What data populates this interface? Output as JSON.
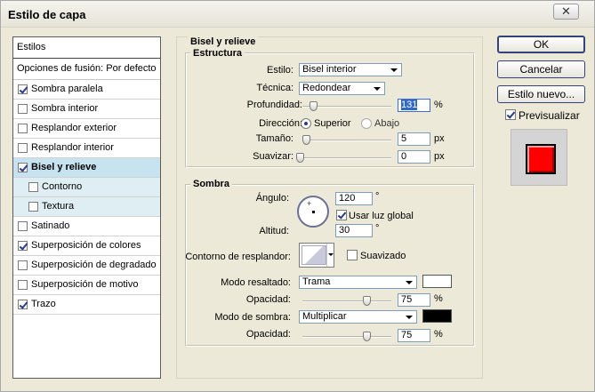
{
  "window": {
    "title": "Estilo de capa",
    "close_label": "✕"
  },
  "styles": {
    "header": "Estilos",
    "blend_options": "Opciones de fusión: Por defecto",
    "items": [
      {
        "label": "Sombra paralela",
        "checked": true
      },
      {
        "label": "Sombra interior",
        "checked": false
      },
      {
        "label": "Resplandor exterior",
        "checked": false
      },
      {
        "label": "Resplandor interior",
        "checked": false
      },
      {
        "label": "Bisel y relieve",
        "checked": true,
        "active": true
      },
      {
        "label": "Contorno",
        "checked": false,
        "sub": true
      },
      {
        "label": "Textura",
        "checked": false,
        "sub": true
      },
      {
        "label": "Satinado",
        "checked": false
      },
      {
        "label": "Superposición de colores",
        "checked": true
      },
      {
        "label": "Superposición de degradado",
        "checked": false
      },
      {
        "label": "Superposición de motivo",
        "checked": false
      },
      {
        "label": "Trazo",
        "checked": true
      }
    ]
  },
  "bevel": {
    "section_title": "Bisel y relieve",
    "structure": {
      "legend": "Estructura",
      "style_label": "Estilo:",
      "style_value": "Bisel interior",
      "technique_label": "Técnica:",
      "technique_value": "Redondear",
      "depth_label": "Profundidad:",
      "depth_value": "131",
      "depth_unit": "%",
      "direction_label": "Dirección:",
      "dir_up": "Superior",
      "dir_down": "Abajo",
      "size_label": "Tamaño:",
      "size_value": "5",
      "size_unit": "px",
      "soften_label": "Suavizar:",
      "soften_value": "0",
      "soften_unit": "px"
    },
    "shading": {
      "legend": "Sombra",
      "angle_label": "Ángulo:",
      "angle_value": "120",
      "angle_unit": "°",
      "global_light": "Usar luz global",
      "altitude_label": "Altitud:",
      "altitude_value": "30",
      "altitude_unit": "°",
      "gloss_label": "Contorno de resplandor:",
      "antialiased": "Suavizado",
      "highlight_label": "Modo resaltado:",
      "highlight_value": "Trama",
      "highlight_color": "#ffffff",
      "highlight_opacity_label": "Opacidad:",
      "highlight_opacity": "75",
      "highlight_opacity_unit": "%",
      "shadow_label": "Modo de sombra:",
      "shadow_value": "Multiplicar",
      "shadow_color": "#000000",
      "shadow_opacity_label": "Opacidad:",
      "shadow_opacity": "75",
      "shadow_opacity_unit": "%"
    }
  },
  "buttons": {
    "ok": "OK",
    "cancel": "Cancelar",
    "new_style": "Estilo nuevo..."
  },
  "preview": {
    "label": "Previsualizar",
    "checked": true,
    "color": "#ff0000"
  }
}
